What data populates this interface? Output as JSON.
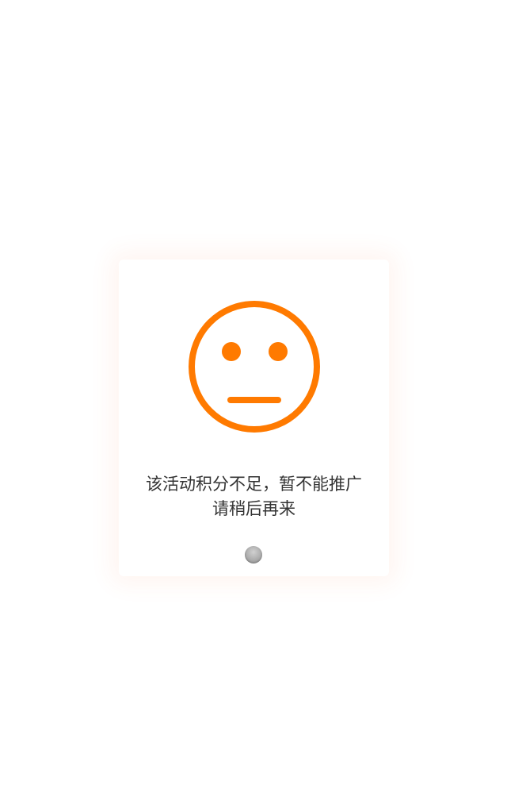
{
  "dialog": {
    "message_line1": "该活动积分不足，暂不能推广",
    "message_line2": "请稍后再来",
    "icon": "neutral-face-icon",
    "accent_color": "#FF7A00"
  }
}
